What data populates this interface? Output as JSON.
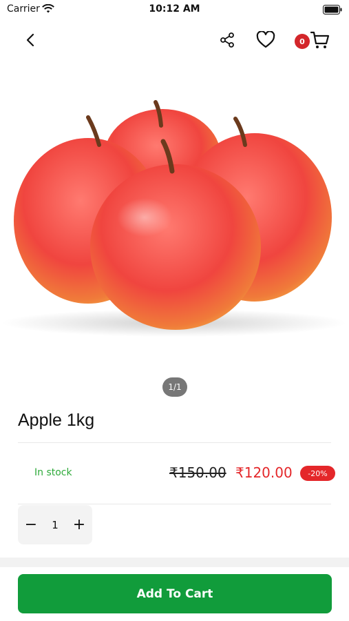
{
  "status_bar": {
    "carrier": "Carrier",
    "time": "10:12 AM"
  },
  "header": {
    "cart_count": "0",
    "icons": [
      "back-icon",
      "share-icon",
      "heart-icon",
      "cart-icon"
    ]
  },
  "gallery": {
    "page_indicator": "1/1",
    "image": "apples-photo"
  },
  "product": {
    "title": "Apple 1kg",
    "stock_status": "In stock",
    "original_price": "₹150.00",
    "sale_price": "₹120.00",
    "discount_badge": "-20%"
  },
  "quantity": {
    "minus": "−",
    "value": "1",
    "plus": "+"
  },
  "actions": {
    "add_to_cart": "Add To Cart"
  },
  "colors": {
    "accent_green": "#119c3b",
    "stock_green": "#2eaa3a",
    "price_red": "#e4272a",
    "badge_red": "#d3262a"
  }
}
